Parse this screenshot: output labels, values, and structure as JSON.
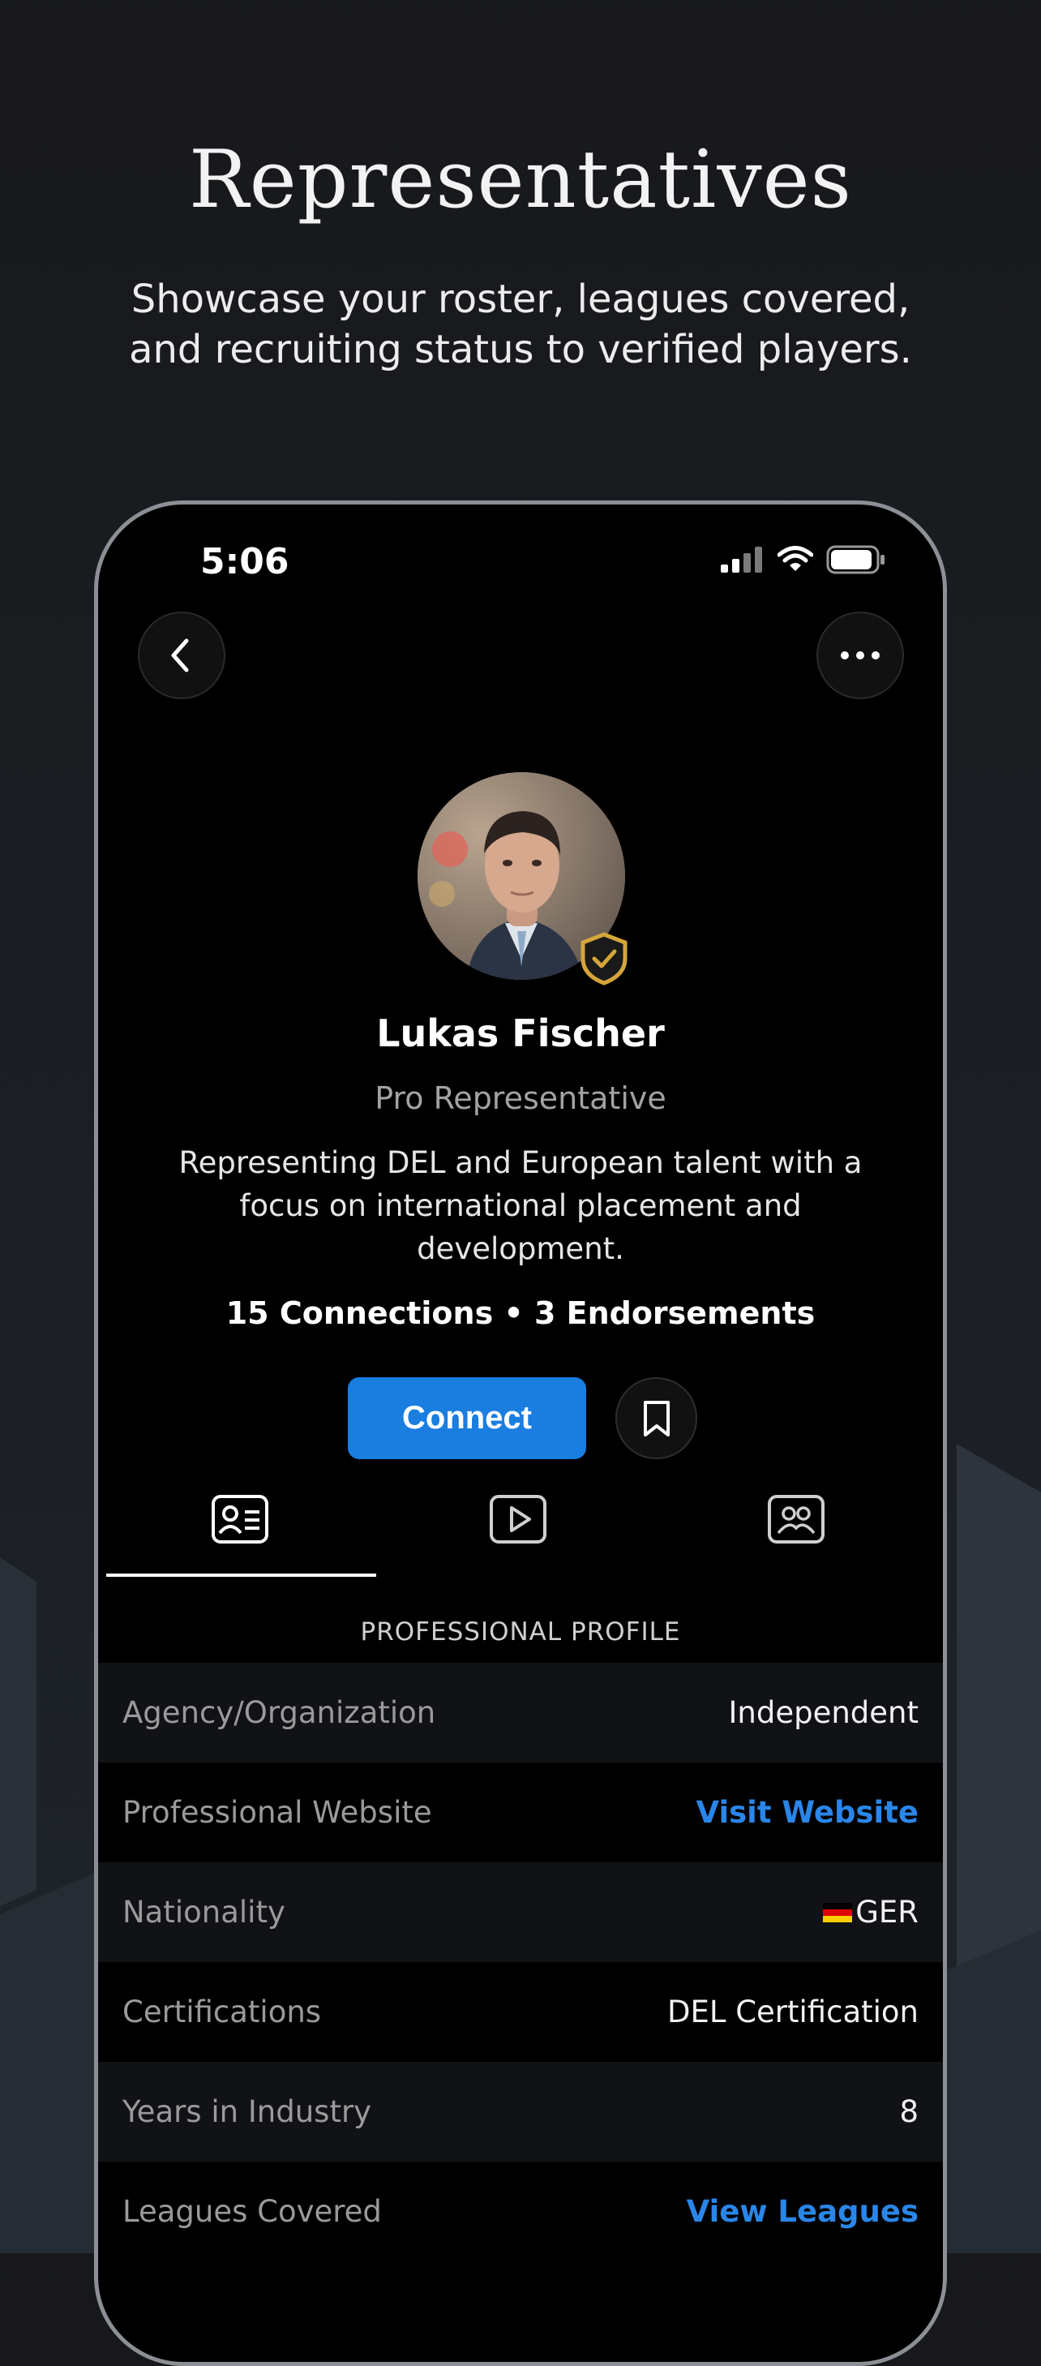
{
  "promo": {
    "headline": "Representatives",
    "subtitle_line1": "Showcase your roster, leagues covered,",
    "subtitle_line2": "and recruiting status to verified players."
  },
  "status_bar": {
    "time": "5:06"
  },
  "profile": {
    "name": "Lukas Fischer",
    "role": "Pro Representative",
    "bio": "Representing DEL and European talent with a focus on international placement and development.",
    "stats": "15 Connections • 3 Endorsements",
    "connect_label": "Connect"
  },
  "tabs": [
    {
      "icon": "profile-card-icon",
      "active": true
    },
    {
      "icon": "video-play-icon",
      "active": false
    },
    {
      "icon": "group-icon",
      "active": false
    }
  ],
  "section_title": "PROFESSIONAL PROFILE",
  "details": {
    "agency": {
      "label": "Agency/Organization",
      "value": "Independent"
    },
    "website": {
      "label": "Professional Website",
      "value": "Visit Website"
    },
    "nationality": {
      "label": "Nationality",
      "value": "GER"
    },
    "certifications": {
      "label": "Certifications",
      "value": "DEL Certification"
    },
    "years": {
      "label": "Years in Industry",
      "value": "8"
    },
    "leagues": {
      "label": "Leagues Covered",
      "value": "View Leagues"
    }
  },
  "colors": {
    "accent": "#1a7de0",
    "link": "#2a86e8",
    "badge": "#d4a63a"
  }
}
